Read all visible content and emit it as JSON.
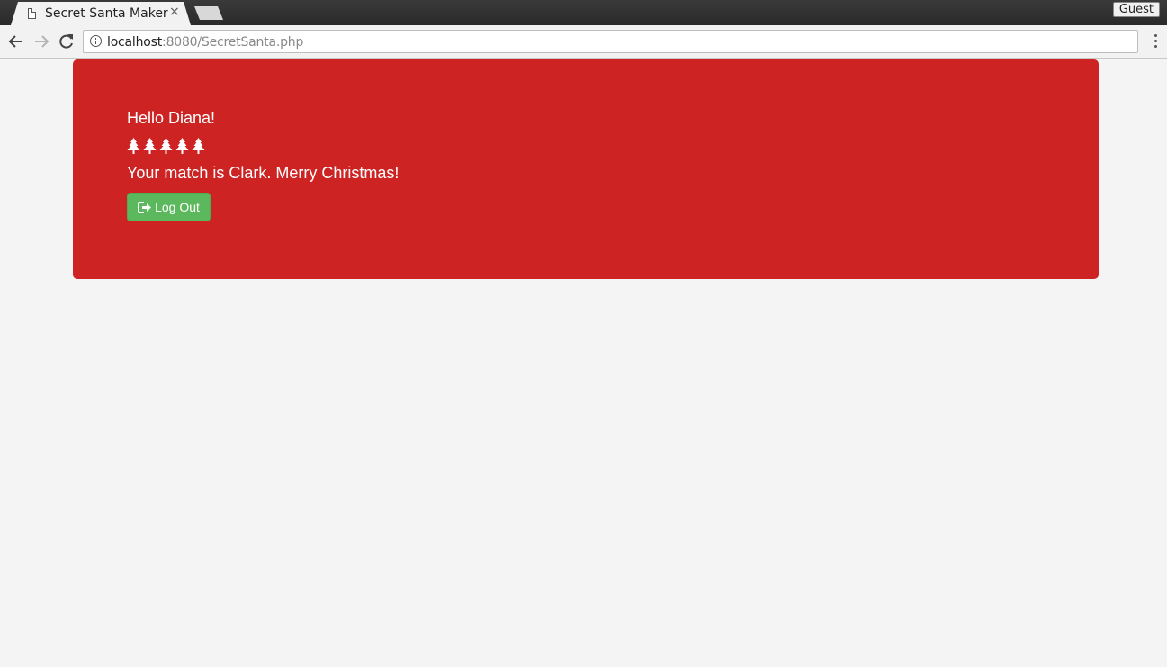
{
  "browser": {
    "tab_title": "Secret Santa Maker",
    "tab_close": "×",
    "profile_label": "Guest",
    "url_host": "localhost",
    "url_rest": ":8080/SecretSanta.php"
  },
  "page": {
    "greeting": "Hello Diana!",
    "tree_count": 5,
    "tree_icon": "tree-icon",
    "match_text": "Your match is Clark. Merry Christmas!",
    "logout_label": "Log Out",
    "logout_icon": "sign-out-icon",
    "colors": {
      "panel": "#cd2323",
      "button": "#5cb85c",
      "text": "#ffffff"
    }
  }
}
